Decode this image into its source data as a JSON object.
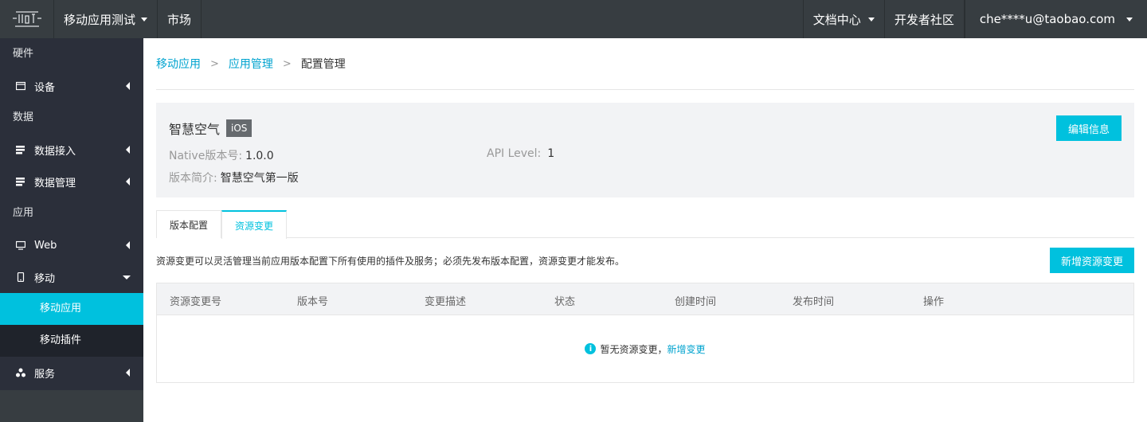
{
  "topbar": {
    "logo_icon": "iot-logo-icon",
    "app_selector": "移动应用测试",
    "market": "市场",
    "docs": "文档中心",
    "community": "开发者社区",
    "account": "che****u@taobao.com"
  },
  "sidebar": {
    "sections": {
      "hardware": "硬件",
      "data": "数据",
      "app": "应用"
    },
    "items": {
      "device": "设备",
      "data_access": "数据接入",
      "data_manage": "数据管理",
      "web": "Web",
      "mobile": "移动",
      "mobile_app": "移动应用",
      "mobile_plugin": "移动插件",
      "service": "服务"
    }
  },
  "breadcrumb": {
    "level1": "移动应用",
    "level2": "应用管理",
    "current": "配置管理",
    "separator": ">"
  },
  "app_info": {
    "name": "智慧空气",
    "platform": "iOS",
    "native_label": "Native版本号:",
    "native_value": "1.0.0",
    "api_label": "API Level:",
    "api_value": "1",
    "intro_label": "版本简介:",
    "intro_value": "智慧空气第一版",
    "edit_button": "编辑信息"
  },
  "tabs": [
    {
      "label": "版本配置",
      "active": false
    },
    {
      "label": "资源变更",
      "active": true
    }
  ],
  "resource": {
    "description": "资源变更可以灵活管理当前应用版本配置下所有使用的插件及服务；必须先发布版本配置，资源变更才能发布。",
    "add_button": "新增资源变更"
  },
  "table": {
    "columns": [
      "资源变更号",
      "版本号",
      "变更描述",
      "状态",
      "创建时间",
      "发布时间",
      "操作"
    ],
    "empty_text": "暂无资源变更，",
    "empty_link": "新增变更",
    "empty_icon": "info-icon"
  },
  "colors": {
    "accent": "#00c1de",
    "link": "#00a3cf",
    "topbar": "#373d41",
    "sidebar": "#2b2f3a"
  }
}
